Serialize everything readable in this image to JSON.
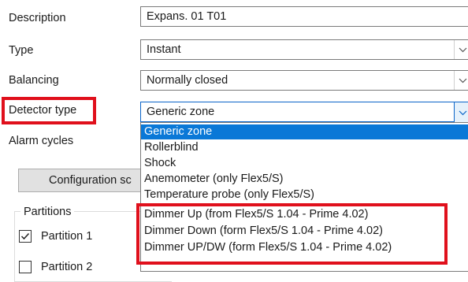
{
  "form": {
    "description": {
      "label": "Description",
      "value": "Expans. 01 T01"
    },
    "type": {
      "label": "Type",
      "value": "Instant"
    },
    "balancing": {
      "label": "Balancing",
      "value": "Normally closed"
    },
    "detector_type": {
      "label": "Detector type",
      "value": "Generic zone"
    },
    "alarm_cycles": {
      "label": "Alarm cycles"
    }
  },
  "configuration_button": {
    "label": "Configuration sc"
  },
  "partitions": {
    "title": "Partitions",
    "items": [
      {
        "label": "Partition 1",
        "checked": true
      },
      {
        "label": "Partition 2",
        "checked": false
      }
    ]
  },
  "dropdown": {
    "options": [
      "Generic zone",
      "Rollerblind",
      "Shock",
      "Anemometer (only Flex5/S)",
      "Temperature probe (only Flex5/S)",
      "Dimmer Up (from Flex5/S 1.04 - Prime 4.02)",
      "Dimmer Down (form Flex5/S 1.04 - Prime 4.02)",
      "Dimmer UP/DW (form Flex5/S 1.04 - Prime 4.02)"
    ],
    "selected_index": 0
  },
  "icons": {
    "dropdown_arrow": "chevron-down-icon",
    "checkbox_check": "checkmark-icon"
  },
  "colors": {
    "highlight_box": "#e0101c",
    "selection": "#0a78d7",
    "focus_border": "#0a64c8"
  }
}
